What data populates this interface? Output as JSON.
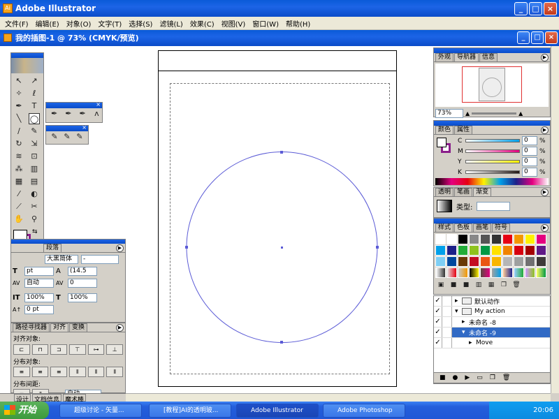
{
  "app": {
    "title": "Adobe Illustrator",
    "icon_label": "Ai"
  },
  "window_buttons": {
    "min": "_",
    "max": "□",
    "close": "×"
  },
  "menu": [
    "文件(F)",
    "编辑(E)",
    "对象(O)",
    "文字(T)",
    "选择(S)",
    "滤镜(L)",
    "效果(C)",
    "视图(V)",
    "窗口(W)",
    "帮助(H)"
  ],
  "document": {
    "title": "我的插图-1 @ 73% (CMYK/预览)"
  },
  "navigator": {
    "tabs": [
      "外观",
      "导航器",
      "信息"
    ],
    "active": 1,
    "zoom": "73%"
  },
  "color_panel": {
    "tabs": [
      "颜色",
      "属性"
    ],
    "active": 0,
    "channels": [
      {
        "label": "C",
        "value": "0",
        "unit": "%",
        "color": "#00a0e9"
      },
      {
        "label": "M",
        "value": "0",
        "unit": "%",
        "color": "#e4007f"
      },
      {
        "label": "Y",
        "value": "0",
        "unit": "%",
        "color": "#fff100"
      },
      {
        "label": "K",
        "value": "0",
        "unit": "%",
        "color": "#231815"
      }
    ]
  },
  "gradient_panel": {
    "tabs": [
      "透明",
      "笔画",
      "渐变"
    ],
    "active": 2,
    "type_label": "类型:"
  },
  "swatches_panel": {
    "tabs": [
      "样式",
      "色板",
      "画笔",
      "符号"
    ],
    "active": 1
  },
  "actions_panel": {
    "items": [
      {
        "label": "默认动作",
        "kind": "set",
        "open": false,
        "indent": 0
      },
      {
        "label": "My action",
        "kind": "set",
        "open": true,
        "indent": 0
      },
      {
        "label": "未命名 -8",
        "kind": "action",
        "open": false,
        "indent": 1
      },
      {
        "label": "未命名 -9",
        "kind": "action",
        "open": true,
        "indent": 1,
        "selected": true
      },
      {
        "label": "Move",
        "kind": "step",
        "open": false,
        "indent": 2
      }
    ]
  },
  "char_panel": {
    "tab": "段落",
    "font": "大黑简体",
    "style": "-",
    "size": "pt",
    "leading": "(14.5",
    "tracking": "自动",
    "kerning": "0",
    "vscale": "100%",
    "hscale": "100%",
    "baseline": "0 pt"
  },
  "align_panel": {
    "tabs": [
      "路径寻找器",
      "对齐",
      "变换"
    ],
    "active": 1,
    "align_objects": "对齐对象:",
    "distribute_objects": "分布对象:",
    "distribute_spacing": "分布间距:",
    "spacing_value": "自动"
  },
  "status": {
    "tabs": [
      "设计",
      "文档信息",
      "魔术棒"
    ]
  },
  "taskbar": {
    "start": "开始",
    "buttons": [
      "超级讨论 - 矢量...",
      "[教程]AI的透明玻...",
      "Adobe Illustrator",
      "Adobe Photoshop"
    ],
    "active": 2,
    "time": "20:06"
  },
  "colors": {
    "accent": "#0a5ad8",
    "path_stroke": "#5b5bd6",
    "selection": "#316ac5"
  }
}
